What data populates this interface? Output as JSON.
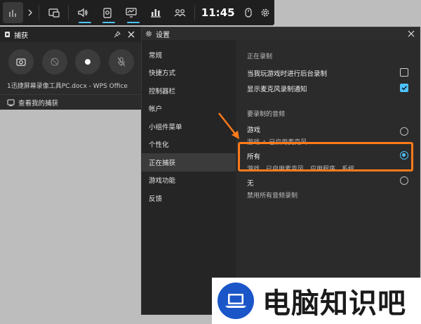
{
  "gamebar": {
    "time": "11:45",
    "buttons": [
      {
        "icon": "widget-menu-icon",
        "active": false
      },
      {
        "icon": "audio-icon",
        "active": true
      },
      {
        "icon": "capture-icon",
        "active": true
      },
      {
        "icon": "performance-icon",
        "active": true
      },
      {
        "icon": "resources-icon",
        "active": false
      },
      {
        "icon": "xbox-social-icon",
        "active": false
      }
    ]
  },
  "capture": {
    "title": "捕获",
    "file_name": "1迅捷屏幕录像工具PC.docx - WPS Office",
    "footer_label": "查看我的捕获"
  },
  "settings": {
    "title": "设置",
    "nav": [
      {
        "label": "常规",
        "active": false
      },
      {
        "label": "快捷方式",
        "active": false
      },
      {
        "label": "控制器栏",
        "active": false
      },
      {
        "label": "帐户",
        "active": false
      },
      {
        "label": "小组件菜单",
        "active": false
      },
      {
        "label": "个性化",
        "active": false
      },
      {
        "label": "正在捕获",
        "active": true
      },
      {
        "label": "游戏功能",
        "active": false
      },
      {
        "label": "反馈",
        "active": false
      }
    ],
    "recording_header": "正在录制",
    "options": {
      "background_record": {
        "label": "当我玩游戏时进行后台录制",
        "checked": false
      },
      "mic_notify": {
        "label": "显示麦克风录制通知",
        "checked": true
      }
    },
    "audio_header": "要录制的音频",
    "audio_choices": [
      {
        "title": "游戏",
        "desc": "游戏 + 已启用麦克风",
        "selected": false
      },
      {
        "title": "所有",
        "desc": "游戏、已启用麦克风、应用程序、系统",
        "selected": true
      },
      {
        "title": "无",
        "desc": "禁用所有音频录制",
        "selected": false
      }
    ]
  },
  "watermark": {
    "text": "电脑知识吧"
  },
  "colors": {
    "accent": "#4cc2ff",
    "highlight": "#ff7a1a",
    "logo_blue": "#1b56c9"
  }
}
